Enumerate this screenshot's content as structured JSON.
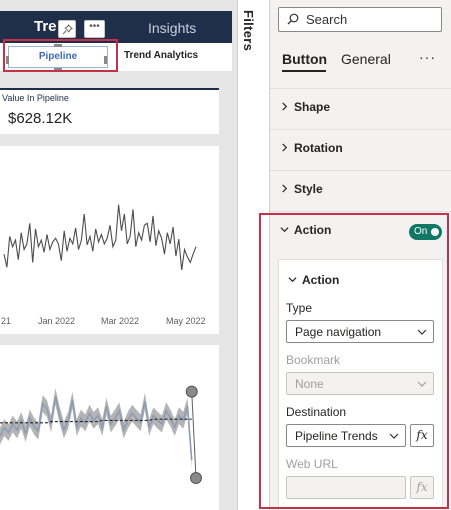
{
  "colors": {
    "accent": "#117865",
    "highlight": "#c4314b",
    "nav": "#1f2f4a",
    "series_line": "#4d4d4d",
    "series_band": "#8e9db5"
  },
  "canvas": {
    "nav": {
      "title": "Tre",
      "insights": "Insights",
      "more": "•••"
    },
    "tabs": {
      "pipeline": "Pipeline",
      "trend": "Trend Analytics"
    },
    "kpi": {
      "label": "Value In Pipeline",
      "value": "$628.12K"
    },
    "line_chart": {
      "x_labels": [
        "21",
        "Jan 2022",
        "Mar 2022",
        "May 2022"
      ]
    }
  },
  "chart_data": [
    {
      "type": "line",
      "x": [
        "2021-11-01",
        "2021-11-04",
        "2021-11-07",
        "2021-11-10",
        "2021-11-13",
        "2021-11-16",
        "2021-11-19",
        "2021-11-22",
        "2021-11-25",
        "2021-11-28",
        "2021-12-01",
        "2021-12-04",
        "2021-12-07",
        "2021-12-10",
        "2021-12-13",
        "2021-12-16",
        "2021-12-19",
        "2021-12-22",
        "2021-12-25",
        "2021-12-28",
        "2021-12-31",
        "2022-01-03",
        "2022-01-06",
        "2022-01-09",
        "2022-01-12",
        "2022-01-15",
        "2022-01-18",
        "2022-01-21",
        "2022-01-24",
        "2022-01-27",
        "2022-01-30",
        "2022-02-02",
        "2022-02-05",
        "2022-02-08",
        "2022-02-11",
        "2022-02-14",
        "2022-02-17",
        "2022-02-20",
        "2022-02-23",
        "2022-02-26",
        "2022-03-01",
        "2022-03-04",
        "2022-03-07",
        "2022-03-10",
        "2022-03-13",
        "2022-03-16",
        "2022-03-19",
        "2022-03-22",
        "2022-03-25",
        "2022-03-28",
        "2022-03-31",
        "2022-04-03",
        "2022-04-06",
        "2022-04-09",
        "2022-04-12",
        "2022-04-15",
        "2022-04-18",
        "2022-04-21",
        "2022-04-24",
        "2022-04-27",
        "2022-04-30",
        "2022-05-03",
        "2022-05-06",
        "2022-05-09",
        "2022-05-12",
        "2022-05-15",
        "2022-05-18",
        "2022-05-21"
      ],
      "values": [
        47,
        33,
        66,
        55,
        62,
        41,
        70,
        52,
        58,
        80,
        38,
        74,
        55,
        62,
        49,
        68,
        52,
        60,
        64,
        58,
        40,
        72,
        50,
        64,
        58,
        75,
        52,
        62,
        90,
        57,
        66,
        50,
        74,
        60,
        68,
        58,
        64,
        78,
        55,
        62,
        100,
        72,
        90,
        58,
        66,
        95,
        55,
        70,
        62,
        78,
        80,
        60,
        88,
        56,
        72,
        64,
        47,
        70,
        58,
        76,
        45,
        63,
        30,
        52,
        44,
        38,
        47,
        55
      ],
      "ylim": [
        0,
        120
      ]
    },
    {
      "type": "area",
      "x": [
        0,
        2,
        4,
        6,
        8,
        10,
        12,
        14,
        16,
        18,
        20,
        22,
        24,
        26,
        28,
        30,
        32,
        34,
        36,
        38,
        40,
        42,
        44,
        46,
        48,
        50,
        52,
        54,
        56,
        58,
        60,
        62,
        64,
        66,
        68,
        70,
        72,
        74,
        76,
        78,
        80,
        82,
        84,
        86,
        88,
        90
      ],
      "series": [
        {
          "values": [
            45,
            52,
            48,
            55,
            50,
            58,
            47,
            60,
            53,
            49,
            72,
            68,
            55,
            78,
            62,
            50,
            58,
            75,
            52,
            60,
            56,
            64,
            58,
            62,
            52,
            70,
            55,
            60,
            66,
            50,
            58,
            64,
            60,
            56,
            74,
            52,
            62,
            58,
            55,
            66,
            60,
            52,
            62,
            58,
            70,
            25
          ]
        },
        {
          "values": [
            56,
            56,
            56,
            56,
            56,
            56,
            56,
            56,
            56,
            56,
            56,
            56,
            57,
            57,
            57,
            57,
            57,
            57,
            57,
            57,
            57,
            57,
            57,
            57,
            58,
            58,
            58,
            58,
            58,
            58,
            58,
            58,
            58,
            58,
            58,
            58,
            59,
            59,
            59,
            59,
            59,
            59,
            59,
            59,
            59,
            59
          ]
        }
      ],
      "markers": [
        {
          "x": 90,
          "y": 82
        },
        {
          "x": 92,
          "y": 10
        }
      ],
      "ylim": [
        0,
        100
      ]
    }
  ],
  "filters": {
    "label": "Filters"
  },
  "pane": {
    "search": {
      "placeholder": "Search"
    },
    "tabs": {
      "button": "Button",
      "general": "General",
      "more": "···"
    },
    "sections": {
      "shape": "Shape",
      "rotation": "Rotation",
      "style": "Style",
      "action": "Action"
    },
    "toggle": {
      "label": "On"
    },
    "action_card": {
      "title": "Action",
      "type": {
        "label": "Type",
        "value": "Page navigation"
      },
      "bookmark": {
        "label": "Bookmark",
        "value": "None"
      },
      "destination": {
        "label": "Destination",
        "value": "Pipeline Trends"
      },
      "web_url": {
        "label": "Web URL",
        "value": ""
      },
      "fx": "fx"
    }
  }
}
